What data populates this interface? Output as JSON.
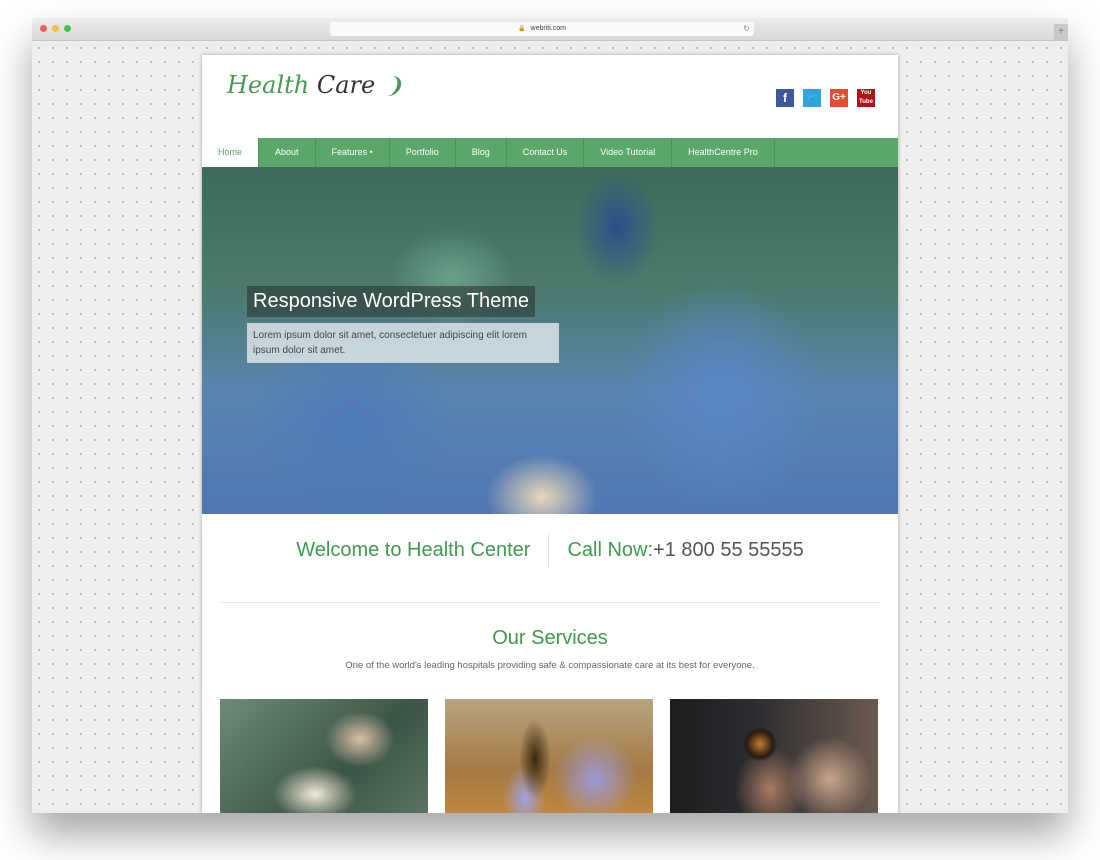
{
  "browser": {
    "url": "webriti.com",
    "lock_icon": "🔒",
    "reload_icon": "↻",
    "new_tab_icon": "+"
  },
  "header": {
    "logo_word1": "Health",
    "logo_word2": "Care",
    "logo_mark": "❩",
    "social": [
      {
        "name": "facebook",
        "glyph": "f",
        "color": "#3b5998"
      },
      {
        "name": "twitter",
        "glyph": "🐦",
        "color": "#2fa4e0"
      },
      {
        "name": "google-plus",
        "glyph": "G+",
        "color": "#e34b32"
      },
      {
        "name": "youtube",
        "glyph": "You Tube",
        "color": "#b31217"
      }
    ]
  },
  "nav": {
    "items": [
      {
        "label": "Home",
        "active": true
      },
      {
        "label": "About"
      },
      {
        "label": "Features •"
      },
      {
        "label": "Portfolio"
      },
      {
        "label": "Blog"
      },
      {
        "label": "Contact Us"
      },
      {
        "label": "Video Tutorial"
      },
      {
        "label": "HealthCentre Pro"
      }
    ],
    "color": "#5aa769"
  },
  "hero": {
    "title": "Responsive WordPress Theme",
    "text": "Lorem ipsum dolor sit amet, consectetuer adipiscing elit lorem ipsum dolor sit amet."
  },
  "welcome": {
    "left": "Welcome to Health Center",
    "call_label": "Call Now:",
    "phone": "+1 800 55 55555"
  },
  "services": {
    "title": "Our Services",
    "subtitle": "One of the world's leading hospitals providing safe & compassionate care at its best for everyone.",
    "cards": [
      {
        "image": "surgery-hands"
      },
      {
        "image": "lab-sample-vial"
      },
      {
        "image": "eye-examination"
      }
    ]
  },
  "colors": {
    "accent_green": "#3e9a4e"
  }
}
